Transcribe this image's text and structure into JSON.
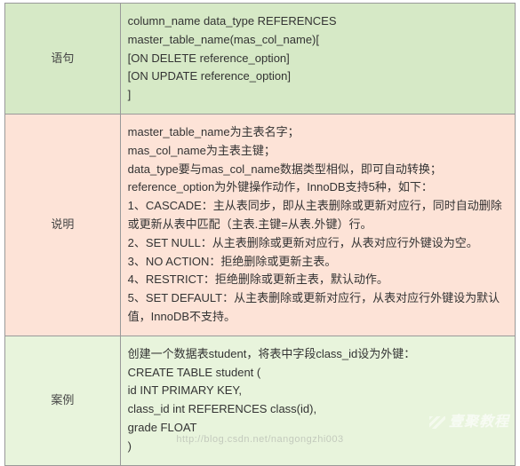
{
  "rows": [
    {
      "label": "语句",
      "lines": [
        "column_name  data_type REFERENCES master_table_name(mas_col_name)[",
        "[ON DELETE reference_option]",
        "[ON UPDATE reference_option]",
        "]"
      ]
    },
    {
      "label": "说明",
      "lines": [
        "master_table_name为主表名字；",
        "mas_col_name为主表主键；",
        "data_type要与mas_col_name数据类型相似，即可自动转换；",
        "reference_option为外键操作动作，InnoDB支持5种，如下：",
        "1、CASCADE：主从表同步，即从主表删除或更新对应行，同时自动删除或更新从表中匹配（主表.主键=从表.外键）行。",
        "2、SET NULL：从主表删除或更新对应行，从表对应行外键设为空。",
        "3、NO ACTION：拒绝删除或更新主表。",
        "4、RESTRICT：拒绝删除或更新主表，默认动作。",
        "5、SET DEFAULT：从主表删除或更新对应行，从表对应行外键设为默认值，InnoDB不支持。"
      ]
    },
    {
      "label": "案例",
      "lines": [
        "创建一个数据表student，将表中字段class_id设为外键：",
        "CREATE TABLE student (",
        "        id INT PRIMARY KEY,",
        "        class_id int REFERENCES class(id),",
        "        grade FLOAT",
        ")"
      ]
    }
  ],
  "watermark_brand": "壹聚教程",
  "watermark_url": "http://blog.csdn.net/nangongzhi003"
}
